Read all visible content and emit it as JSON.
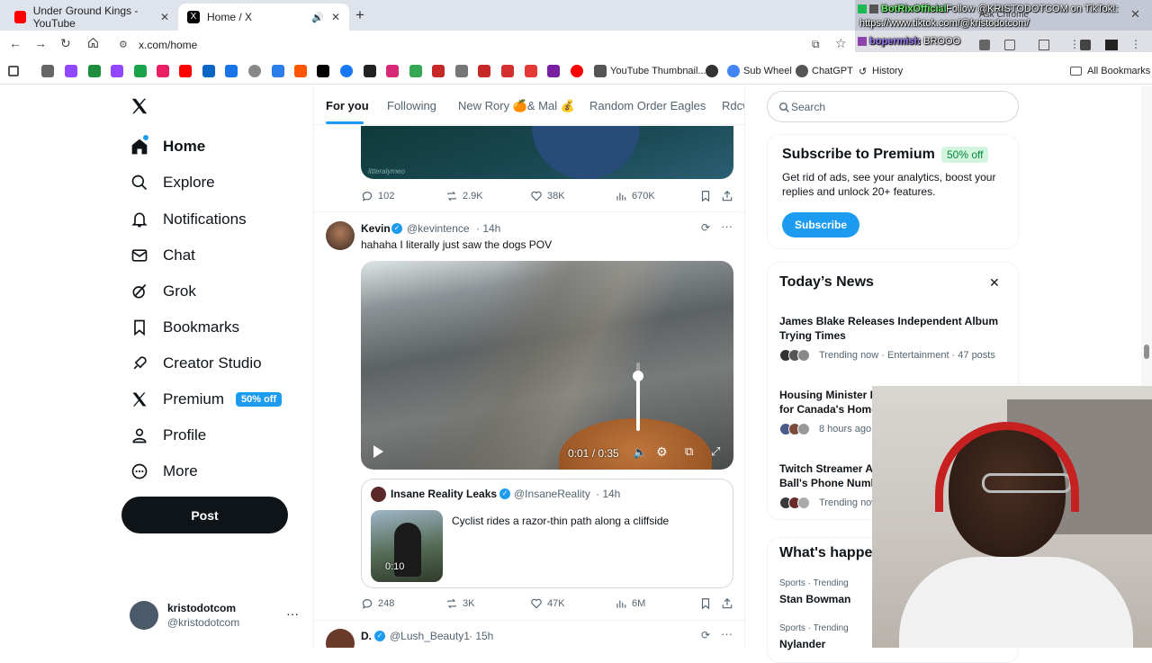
{
  "browser": {
    "tabs": [
      {
        "title": "Under Ground Kings - YouTube"
      },
      {
        "title": "Home / X"
      }
    ],
    "url": "x.com/home",
    "ask_chrome": "Ask Chrome",
    "bookmarks": {
      "youtube_thumbnail": "YouTube Thumbnail...",
      "sub_wheel": "Sub Wheel",
      "chatgpt": "ChatGPT",
      "history": "History",
      "all_bookmarks": "All Bookmarks"
    }
  },
  "overlay": {
    "line1_user": "BotRixOfficial",
    "line1_text": ": Follow @KRISTODOTCOM on TikTok!:",
    "line2_text": "https://www.tiktok.com/@kristodotcom/",
    "line3_user": "bopermish",
    "line3_text": ": BROOO"
  },
  "sidebar": {
    "items": [
      {
        "label": "Home"
      },
      {
        "label": "Explore"
      },
      {
        "label": "Notifications"
      },
      {
        "label": "Chat"
      },
      {
        "label": "Grok"
      },
      {
        "label": "Bookmarks"
      },
      {
        "label": "Creator Studio"
      },
      {
        "label": "Premium"
      },
      {
        "label": "Profile"
      },
      {
        "label": "More"
      }
    ],
    "premium_badge": "50% off",
    "post_button": "Post",
    "account": {
      "name": "kristodotcom",
      "handle": "@kristodotcom"
    }
  },
  "feed": {
    "tabs": [
      {
        "label": "For you"
      },
      {
        "label": "Following"
      },
      {
        "label": "New Rory 🍊& Mal 💰"
      },
      {
        "label": "Random Order Eagles"
      },
      {
        "label": "Rdcw"
      }
    ],
    "prev_post": {
      "watermark": "litteralymeo",
      "replies": "102",
      "reposts": "2.9K",
      "likes": "38K",
      "views": "670K"
    },
    "post": {
      "name": "Kevin",
      "handle": "@kevintence",
      "time": "· 14h",
      "text": "hahaha I literally just saw the dogs POV",
      "video_time": "0:01 / 0:35",
      "volume": 0.8,
      "quote": {
        "name": "Insane Reality Leaks",
        "handle": "@InsaneReality",
        "time": "· 14h",
        "text": "Cyclist rides a razor-thin path along a cliffside",
        "duration": "0:10"
      },
      "replies": "248",
      "reposts": "3K",
      "likes": "47K",
      "views": "6M"
    },
    "next_post": {
      "name": "D.",
      "handle": "@Lush_Beauty1",
      "time": "· 15h"
    }
  },
  "right": {
    "search_placeholder": "Search",
    "premium": {
      "title": "Subscribe to Premium",
      "badge": "50% off",
      "text": "Get rid of ads, see your analytics, boost your replies and unlock 20+ features.",
      "button": "Subscribe"
    },
    "news": {
      "title": "Today’s News",
      "items": [
        {
          "title": "James Blake Releases Independent Album Trying Times",
          "meta": "Trending now · Entertainment · 47 posts"
        },
        {
          "title": "Housing Minister E for Canada's Home",
          "meta": "8 hours ago"
        },
        {
          "title": "Twitch Streamer A Ball's Phone Numb",
          "meta": "Trending now"
        }
      ]
    },
    "happening": {
      "title": "What's happe",
      "items": [
        {
          "category": "Sports · Trending",
          "name": "Stan Bowman"
        },
        {
          "category": "Sports · Trending",
          "name": "Nylander"
        }
      ]
    }
  },
  "colors": {
    "accent": "#1d9bf0",
    "badge_bg": "#d3f5dd",
    "badge_text": "#00893d",
    "text": "#0f1419",
    "muted": "#536471"
  }
}
